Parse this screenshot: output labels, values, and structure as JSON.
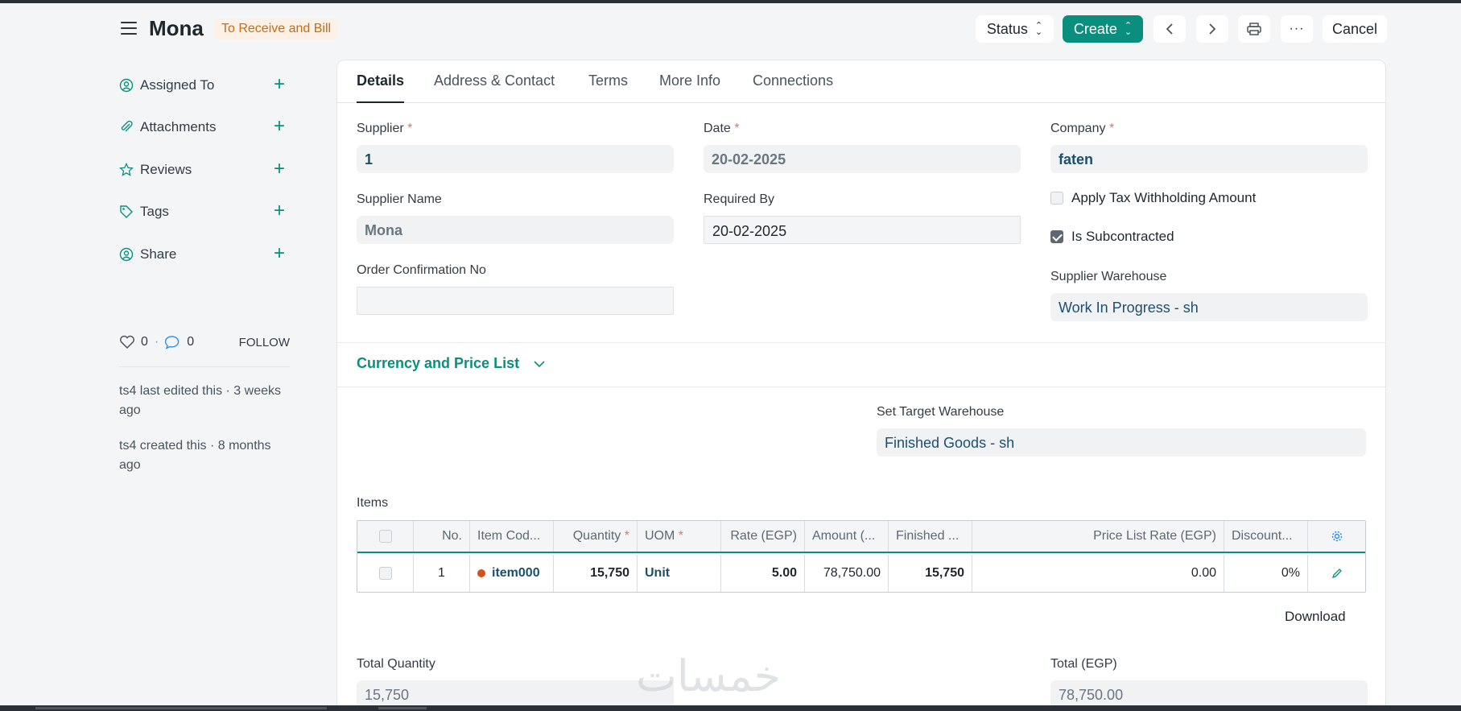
{
  "header": {
    "title": "Mona",
    "status_badge": "To Receive and Bill",
    "status_btn": "Status",
    "create_btn": "Create",
    "cancel_btn": "Cancel",
    "more_icon": "···"
  },
  "sidebar": {
    "items": [
      {
        "label": "Assigned To",
        "icon": "assign-icon"
      },
      {
        "label": "Attachments",
        "icon": "paperclip-icon"
      },
      {
        "label": "Reviews",
        "icon": "star-icon"
      },
      {
        "label": "Tags",
        "icon": "tag-icon"
      },
      {
        "label": "Share",
        "icon": "share-icon"
      }
    ],
    "likes": "0",
    "comments": "0",
    "follow": "FOLLOW",
    "activity": [
      "ts4 last edited this · 3 weeks ago",
      "ts4 created this · 8 months ago"
    ]
  },
  "tabs": [
    "Details",
    "Address & Contact",
    "Terms",
    "More Info",
    "Connections"
  ],
  "form": {
    "supplier_label": "Supplier",
    "supplier_value": "1",
    "supplier_name_label": "Supplier Name",
    "supplier_name_value": "Mona",
    "order_conf_label": "Order Confirmation No",
    "order_conf_value": "",
    "date_label": "Date",
    "date_value": "20-02-2025",
    "required_by_label": "Required By",
    "required_by_value": "20-02-2025",
    "company_label": "Company",
    "company_value": "faten",
    "apply_tax_label": "Apply Tax Withholding Amount",
    "is_subcontracted_label": "Is Subcontracted",
    "supplier_wh_label": "Supplier Warehouse",
    "supplier_wh_value": "Work In Progress - sh",
    "currency_section": "Currency and Price List",
    "target_wh_label": "Set Target Warehouse",
    "target_wh_value": "Finished Goods - sh",
    "items_label": "Items",
    "total_qty_label": "Total Quantity",
    "total_qty_value": "15,750",
    "total_label": "Total (EGP)",
    "total_value": "78,750.00",
    "download": "Download",
    "required_mark": "*"
  },
  "table": {
    "headers": {
      "no": "No.",
      "item_code": "Item Cod...",
      "quantity": "Quantity",
      "uom": "UOM",
      "rate": "Rate (EGP)",
      "amount": "Amount (...",
      "finished": "Finished ...",
      "price_list_rate": "Price List Rate (EGP)",
      "discount": "Discount..."
    },
    "row": {
      "no": "1",
      "item_code": "item000",
      "quantity": "15,750",
      "uom": "Unit",
      "rate": "5.00",
      "amount": "78,750.00",
      "finished": "15,750",
      "price_list_rate": "0.00",
      "discount": "0%"
    }
  },
  "watermark": "خمسات",
  "colors": {
    "accent": "#0a8f7e",
    "badge_bg": "#fdf1e6",
    "badge_text": "#c46b1c",
    "link": "#1c4f6e"
  }
}
